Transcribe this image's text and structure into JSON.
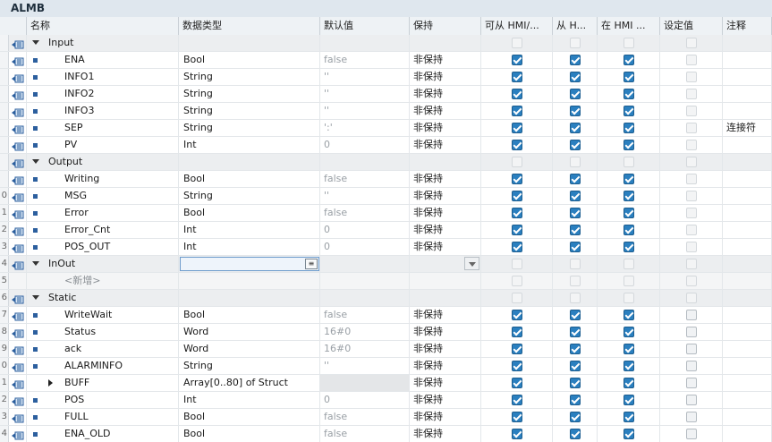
{
  "block_title": "ALMB",
  "columns": {
    "name": "名称",
    "type": "数据类型",
    "default": "默认值",
    "retain": "保持",
    "hmi_access": "可从 HMI/...",
    "hmi_write": "从 H...",
    "hmi_visible": "在 HMI ...",
    "setpoint": "设定值",
    "comment": "注释"
  },
  "colors": {
    "accent": "#2a7fbf",
    "section_bg": "#eceef0",
    "icon_blue": "#2c5f9e"
  },
  "rows": [
    {
      "num": "",
      "kind": "section",
      "name": "Input",
      "type": "",
      "default": "",
      "retain": "",
      "cb": [
        "dis",
        "dis",
        "dis",
        "dis"
      ],
      "comment": ""
    },
    {
      "num": "",
      "kind": "var",
      "name": "ENA",
      "type": "Bool",
      "default": "false",
      "retain": "非保持",
      "cb": [
        "on",
        "on",
        "on",
        "dis"
      ],
      "comment": ""
    },
    {
      "num": "",
      "kind": "var",
      "name": "INFO1",
      "type": "String",
      "default": "''",
      "retain": "非保持",
      "cb": [
        "on",
        "on",
        "on",
        "dis"
      ],
      "comment": ""
    },
    {
      "num": "",
      "kind": "var",
      "name": "INFO2",
      "type": "String",
      "default": "''",
      "retain": "非保持",
      "cb": [
        "on",
        "on",
        "on",
        "dis"
      ],
      "comment": ""
    },
    {
      "num": "",
      "kind": "var",
      "name": "INFO3",
      "type": "String",
      "default": "''",
      "retain": "非保持",
      "cb": [
        "on",
        "on",
        "on",
        "dis"
      ],
      "comment": ""
    },
    {
      "num": "",
      "kind": "var",
      "name": "SEP",
      "type": "String",
      "default": "':'",
      "retain": "非保持",
      "cb": [
        "on",
        "on",
        "on",
        "dis"
      ],
      "comment": "连接符"
    },
    {
      "num": "",
      "kind": "var",
      "name": "PV",
      "type": "Int",
      "default": "0",
      "retain": "非保持",
      "cb": [
        "on",
        "on",
        "on",
        "dis"
      ],
      "comment": ""
    },
    {
      "num": "",
      "kind": "section",
      "name": "Output",
      "type": "",
      "default": "",
      "retain": "",
      "cb": [
        "dis",
        "dis",
        "dis",
        "dis"
      ],
      "comment": ""
    },
    {
      "num": "",
      "kind": "var",
      "name": "Writing",
      "type": "Bool",
      "default": "false",
      "retain": "非保持",
      "cb": [
        "on",
        "on",
        "on",
        "dis"
      ],
      "comment": ""
    },
    {
      "num": "0",
      "kind": "var",
      "name": "MSG",
      "type": "String",
      "default": "''",
      "retain": "非保持",
      "cb": [
        "on",
        "on",
        "on",
        "dis"
      ],
      "comment": ""
    },
    {
      "num": "1",
      "kind": "var",
      "name": "Error",
      "type": "Bool",
      "default": "false",
      "retain": "非保持",
      "cb": [
        "on",
        "on",
        "on",
        "dis"
      ],
      "comment": ""
    },
    {
      "num": "2",
      "kind": "var",
      "name": "Error_Cnt",
      "type": "Int",
      "default": "0",
      "retain": "非保持",
      "cb": [
        "on",
        "on",
        "on",
        "dis"
      ],
      "comment": ""
    },
    {
      "num": "3",
      "kind": "var",
      "name": "POS_OUT",
      "type": "Int",
      "default": "0",
      "retain": "非保持",
      "cb": [
        "on",
        "on",
        "on",
        "dis"
      ],
      "comment": ""
    },
    {
      "num": "4",
      "kind": "section-edit",
      "name": "InOut",
      "type": "",
      "default": "",
      "retain": "",
      "cb": [
        "dis",
        "dis",
        "dis",
        "dis"
      ],
      "comment": ""
    },
    {
      "num": "5",
      "kind": "new",
      "name": "<新增>",
      "type": "",
      "default": "",
      "retain": "",
      "cb": [
        "dis",
        "dis",
        "dis",
        "dis"
      ],
      "comment": ""
    },
    {
      "num": "6",
      "kind": "section",
      "name": "Static",
      "type": "",
      "default": "",
      "retain": "",
      "cb": [
        "dis",
        "dis",
        "dis",
        "dis"
      ],
      "comment": ""
    },
    {
      "num": "7",
      "kind": "var",
      "name": "WriteWait",
      "type": "Bool",
      "default": "false",
      "retain": "非保持",
      "cb": [
        "on",
        "on",
        "on",
        "off"
      ],
      "comment": ""
    },
    {
      "num": "8",
      "kind": "var",
      "name": "Status",
      "type": "Word",
      "default": "16#0",
      "retain": "非保持",
      "cb": [
        "on",
        "on",
        "on",
        "off"
      ],
      "comment": ""
    },
    {
      "num": "9",
      "kind": "var",
      "name": "ack",
      "type": "Word",
      "default": "16#0",
      "retain": "非保持",
      "cb": [
        "on",
        "on",
        "on",
        "off"
      ],
      "comment": ""
    },
    {
      "num": "0",
      "kind": "var",
      "name": "ALARMINFO",
      "type": "String",
      "default": "''",
      "retain": "非保持",
      "cb": [
        "on",
        "on",
        "on",
        "off"
      ],
      "comment": ""
    },
    {
      "num": "1",
      "kind": "struct",
      "name": "BUFF",
      "type": "Array[0..80] of Struct",
      "default": "",
      "retain": "非保持",
      "cb": [
        "on",
        "on",
        "on",
        "off"
      ],
      "comment": ""
    },
    {
      "num": "2",
      "kind": "var",
      "name": "POS",
      "type": "Int",
      "default": "0",
      "retain": "非保持",
      "cb": [
        "on",
        "on",
        "on",
        "off"
      ],
      "comment": ""
    },
    {
      "num": "3",
      "kind": "var",
      "name": "FULL",
      "type": "Bool",
      "default": "false",
      "retain": "非保持",
      "cb": [
        "on",
        "on",
        "on",
        "off"
      ],
      "comment": ""
    },
    {
      "num": "4",
      "kind": "var",
      "name": "ENA_OLD",
      "type": "Bool",
      "default": "false",
      "retain": "非保持",
      "cb": [
        "on",
        "on",
        "on",
        "off"
      ],
      "comment": ""
    }
  ]
}
